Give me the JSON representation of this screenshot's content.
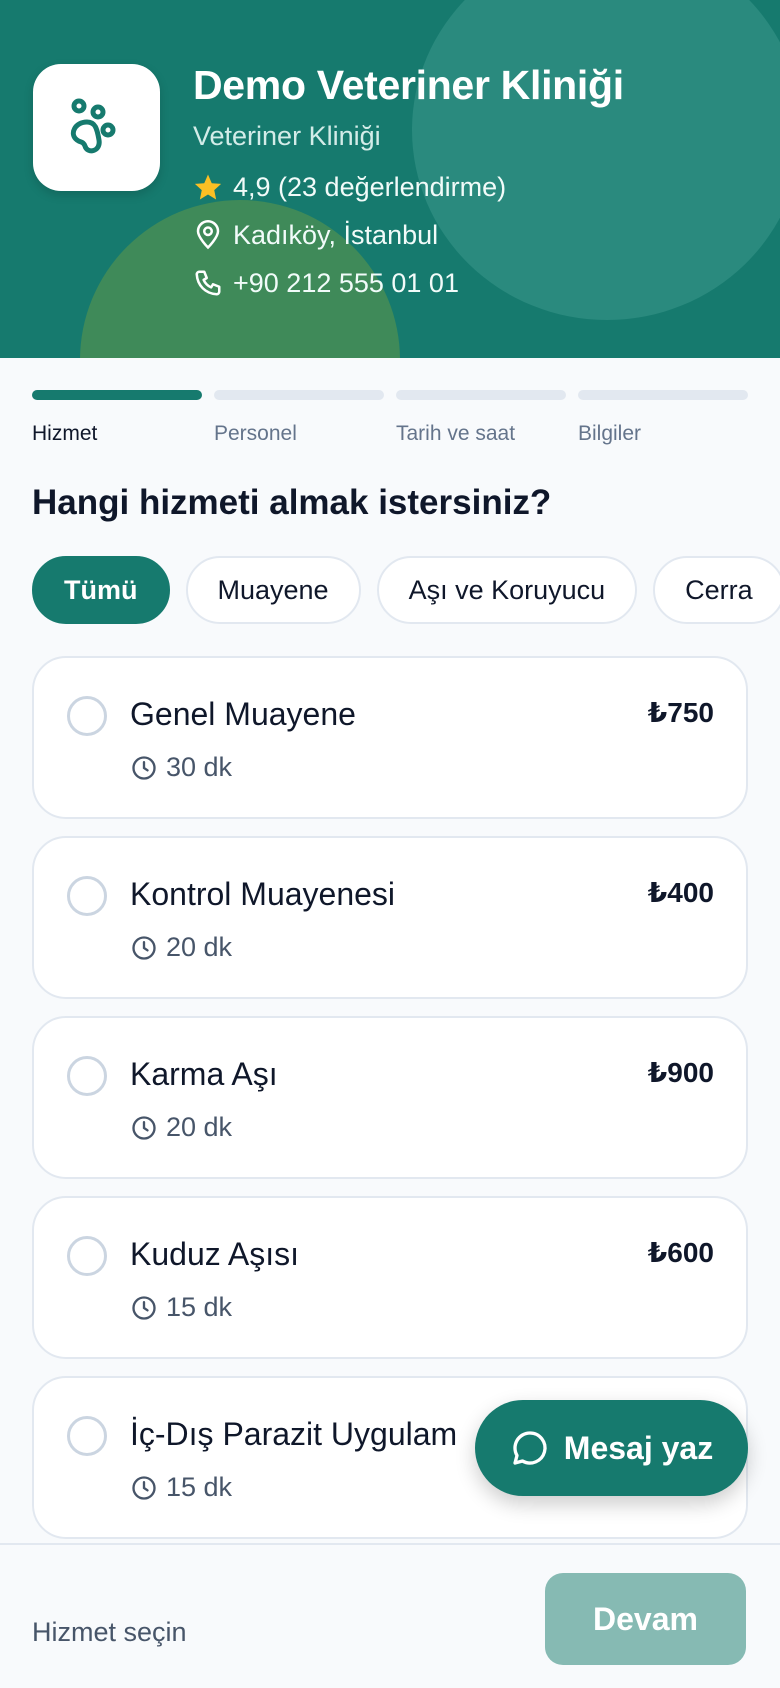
{
  "clinic": {
    "name": "Demo Veteriner Kliniği",
    "type": "Veteriner Kliniği",
    "rating": "4,9 (23 değerlendirme)",
    "location": "Kadıköy, İstanbul",
    "phone": "+90 212 555 01 01"
  },
  "steps": [
    {
      "label": "Hizmet",
      "active": true
    },
    {
      "label": "Personel",
      "active": false
    },
    {
      "label": "Tarih ve saat",
      "active": false
    },
    {
      "label": "Bilgiler",
      "active": false
    }
  ],
  "question": "Hangi hizmeti almak istersiniz?",
  "categories": [
    "Tümü",
    "Muayene",
    "Aşı ve Koruyucu",
    "Cerra"
  ],
  "services": [
    {
      "name": "Genel Muayene",
      "duration": "30 dk",
      "price": "₺750"
    },
    {
      "name": "Kontrol Muayenesi",
      "duration": "20 dk",
      "price": "₺400"
    },
    {
      "name": "Karma Aşı",
      "duration": "20 dk",
      "price": "₺900"
    },
    {
      "name": "Kuduz Aşısı",
      "duration": "15 dk",
      "price": "₺600"
    },
    {
      "name": "İç-Dış Parazit Uygulam",
      "duration": "15 dk",
      "price": ""
    }
  ],
  "message_button": "Mesaj yaz",
  "footer": {
    "hint": "Hizmet seçin",
    "continue": "Devam"
  },
  "colors": {
    "primary": "#167a6e",
    "star": "#fbbf24",
    "disabled_button": "#86bab3"
  }
}
